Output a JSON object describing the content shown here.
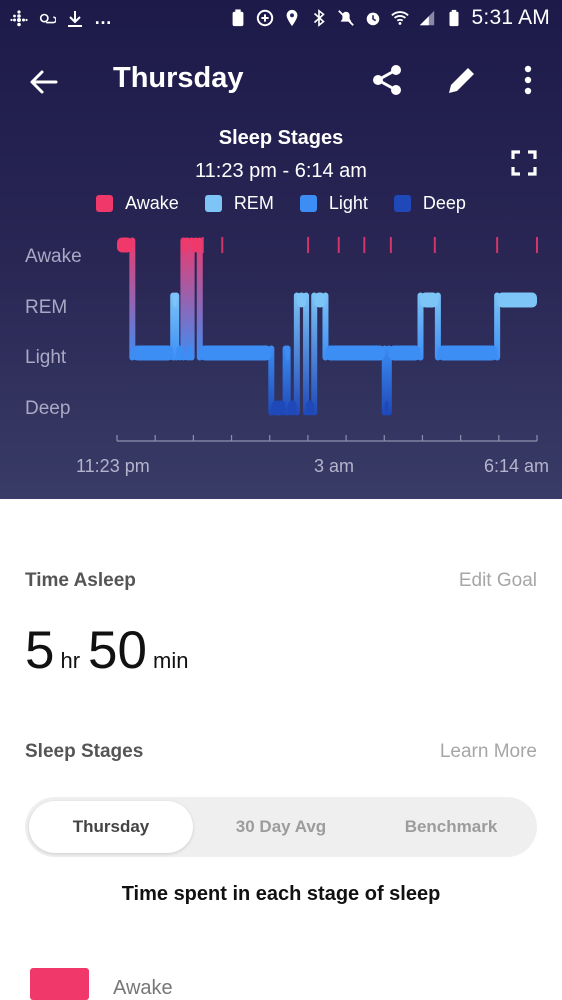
{
  "status_bar": {
    "time": "5:31 AM"
  },
  "header": {
    "title": "Thursday"
  },
  "chart": {
    "title": "Sleep Stages",
    "range": "11:23 pm - 6:14 am",
    "colors": {
      "Awake": "#f0386b",
      "REM": "#7dc4f7",
      "Light": "#3c8ef5",
      "Deep": "#1f48b8"
    }
  },
  "chart_data": {
    "type": "line",
    "legend": [
      "Awake",
      "REM",
      "Light",
      "Deep"
    ],
    "y_categories": [
      "Awake",
      "REM",
      "Light",
      "Deep"
    ],
    "x_tick_labels": [
      "11:23 pm",
      "3 am",
      "6:14 am"
    ],
    "x_range": [
      "23:23",
      "06:14"
    ],
    "stages": [
      {
        "start": "23:23",
        "end": "23:38",
        "stage": "Awake"
      },
      {
        "start": "23:38",
        "end": "00:18",
        "stage": "Light"
      },
      {
        "start": "00:18",
        "end": "00:21",
        "stage": "REM"
      },
      {
        "start": "00:21",
        "end": "00:28",
        "stage": "Light"
      },
      {
        "start": "00:28",
        "end": "00:32",
        "stage": "Awake"
      },
      {
        "start": "00:32",
        "end": "00:36",
        "stage": "Light"
      },
      {
        "start": "00:36",
        "end": "00:44",
        "stage": "Awake"
      },
      {
        "start": "00:44",
        "end": "01:54",
        "stage": "Light"
      },
      {
        "start": "01:54",
        "end": "02:08",
        "stage": "Deep"
      },
      {
        "start": "02:08",
        "end": "02:10",
        "stage": "Light"
      },
      {
        "start": "02:10",
        "end": "02:19",
        "stage": "Deep"
      },
      {
        "start": "02:19",
        "end": "02:28",
        "stage": "REM"
      },
      {
        "start": "02:28",
        "end": "02:36",
        "stage": "Deep"
      },
      {
        "start": "02:36",
        "end": "02:47",
        "stage": "REM"
      },
      {
        "start": "02:47",
        "end": "03:45",
        "stage": "Light"
      },
      {
        "start": "03:45",
        "end": "03:49",
        "stage": "Deep"
      },
      {
        "start": "03:49",
        "end": "04:20",
        "stage": "Light"
      },
      {
        "start": "04:20",
        "end": "04:37",
        "stage": "REM"
      },
      {
        "start": "04:37",
        "end": "05:35",
        "stage": "Light"
      },
      {
        "start": "05:35",
        "end": "06:14",
        "stage": "REM"
      }
    ],
    "brief_awake_marks": [
      "00:47",
      "01:06",
      "02:30",
      "03:00",
      "03:25",
      "03:51",
      "04:34",
      "05:35",
      "06:14"
    ]
  },
  "summary": {
    "time_asleep_label": "Time Asleep",
    "edit_goal": "Edit Goal",
    "hours": "5",
    "hours_unit": "hr",
    "minutes": "50",
    "minutes_unit": "min"
  },
  "stages_section": {
    "label": "Sleep Stages",
    "learn_more": "Learn More",
    "tabs": [
      "Thursday",
      "30 Day Avg",
      "Benchmark"
    ],
    "selected_tab": "Thursday",
    "caption": "Time spent in each stage of sleep",
    "rows": [
      {
        "name": "Awake",
        "color": "#f0386b"
      }
    ]
  }
}
